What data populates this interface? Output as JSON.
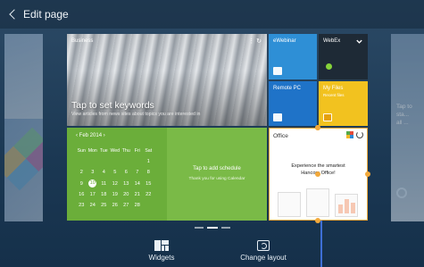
{
  "header": {
    "title": "Edit page"
  },
  "tiles": {
    "business": {
      "name": "Business",
      "headline": "Tap to set keywords",
      "subtext": "View articles from news sites about topics you are interested in"
    },
    "ewebinar": {
      "label": "eWebinar"
    },
    "webex": {
      "label": "WebEx"
    },
    "remotepc": {
      "label": "Remote PC"
    },
    "myfiles": {
      "label": "My Files",
      "sublabel": "Recent files"
    },
    "calendar": {
      "month": "Feb 2014",
      "weekdays": [
        "Sun",
        "Mon",
        "Tue",
        "Wed",
        "Thu",
        "Fri",
        "Sat"
      ],
      "weeks": [
        [
          "",
          "",
          "",
          "",
          "",
          "",
          "1"
        ],
        [
          "2",
          "3",
          "4",
          "5",
          "6",
          "7",
          "8"
        ],
        [
          "9",
          "10",
          "11",
          "12",
          "13",
          "14",
          "15"
        ],
        [
          "16",
          "17",
          "18",
          "19",
          "20",
          "21",
          "22"
        ],
        [
          "23",
          "24",
          "25",
          "26",
          "27",
          "28",
          ""
        ]
      ],
      "today": "10",
      "schedule_prompt": "Tap to add schedule",
      "schedule_sub": "Thank you for using Calendar"
    },
    "office": {
      "label": "Office",
      "message_line1": "Experience the smartest",
      "message_line2": "Hancom Office!"
    }
  },
  "peek_right": {
    "text_line1": "Tap to sta...",
    "text_line2": "all ..."
  },
  "bottom_bar": {
    "widgets_label": "Widgets",
    "change_layout_label": "Change layout"
  },
  "colors": {
    "calendar_green": "#6bae3a",
    "ewebinar_blue": "#2e8fd6",
    "remotepc_blue": "#1f73c8",
    "myfiles_yellow": "#f2c21f",
    "webex_dark": "#1e2a36",
    "handle_orange": "#f2a93b"
  }
}
